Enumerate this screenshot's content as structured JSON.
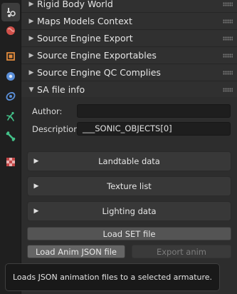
{
  "tabs": [
    {
      "name": "tool-tab",
      "icon": "tool-icon",
      "active": true
    },
    {
      "name": "world-tab",
      "icon": "world-icon",
      "active": false
    },
    {
      "name": "object-tab",
      "icon": "object-icon",
      "active": false
    },
    {
      "name": "modifiers-tab",
      "icon": "modifiers-icon",
      "active": false
    },
    {
      "name": "physics-tab",
      "icon": "physics-icon",
      "active": false
    },
    {
      "name": "constraints-tab",
      "icon": "constraints-icon",
      "active": false
    },
    {
      "name": "data-tab",
      "icon": "bone-icon",
      "active": false
    },
    {
      "name": "texture-tab",
      "icon": "checker-icon",
      "active": false
    }
  ],
  "panels": [
    {
      "label": "Rigid Body World",
      "expanded": false
    },
    {
      "label": "Maps Models Context",
      "expanded": false
    },
    {
      "label": "Source Engine Export",
      "expanded": false
    },
    {
      "label": "Source Engine Exportables",
      "expanded": false
    },
    {
      "label": "Source Engine QC Complies",
      "expanded": false
    },
    {
      "label": "SA file info",
      "expanded": true
    }
  ],
  "sa_file_info": {
    "author_label": "Author:",
    "author_value": "",
    "description_label": "Description:",
    "description_value": "___SONIC_OBJECTS[0]",
    "subpanels": [
      "Landtable data",
      "Texture list",
      "Lighting data"
    ],
    "load_set_button": "Load SET file",
    "load_anim_button": "Load Anim JSON file",
    "export_anim_button": "Export anim"
  },
  "tooltip": "Loads JSON animation files to a selected armature.",
  "colors": {
    "tool": "#d9d9d9",
    "world": "#d0504a",
    "object": "#e08a3c",
    "modifiers": "#5b8fd8",
    "physics": "#5b8fd8",
    "constraints": "#43c189",
    "data": "#43c189",
    "texture": "#c34848"
  }
}
